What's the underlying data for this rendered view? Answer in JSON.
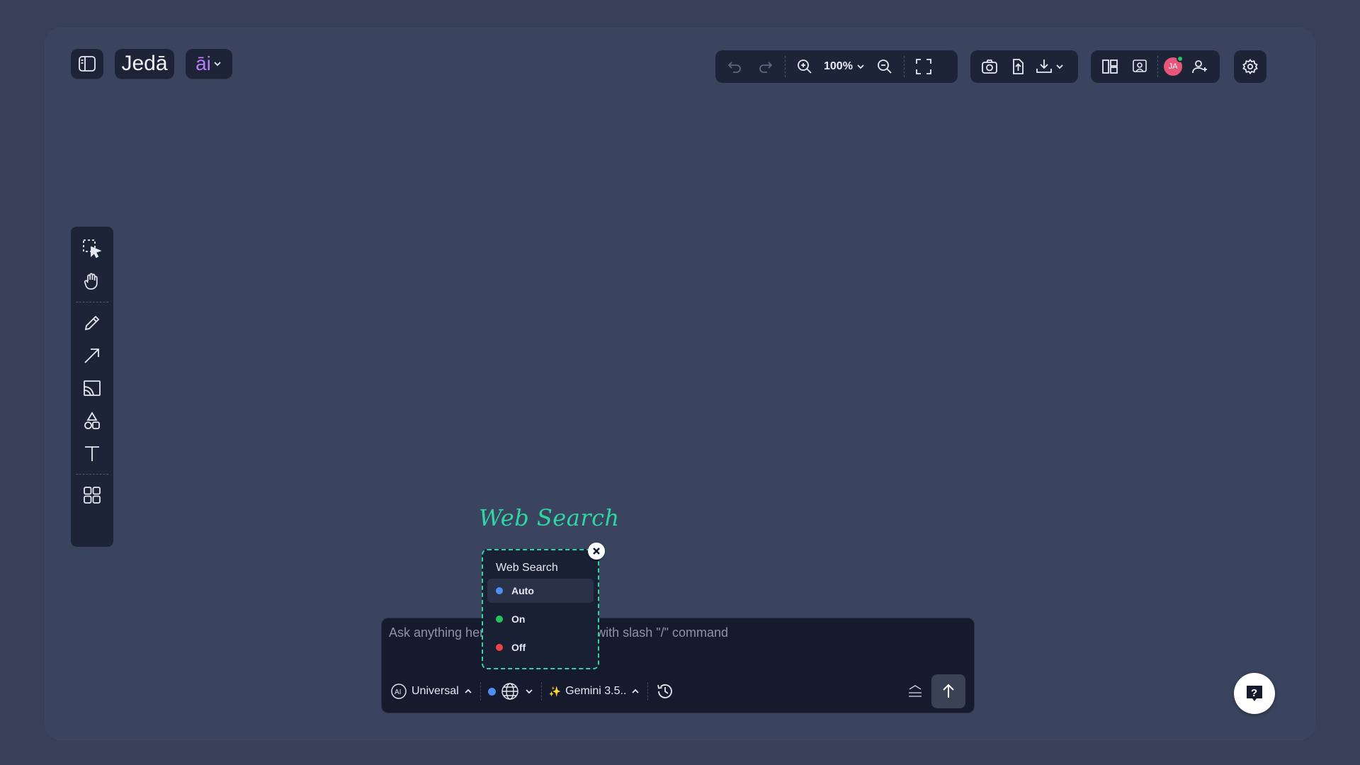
{
  "brand": {
    "logo_text": "Jedā",
    "ai_label": "āi"
  },
  "toolbar": {
    "zoom_level": "100%"
  },
  "user": {
    "initials": "JA"
  },
  "annotation": {
    "label": "Web Search"
  },
  "web_search_popover": {
    "title": "Web Search",
    "options": [
      {
        "label": "Auto",
        "color": "#4f8ef7",
        "selected": true
      },
      {
        "label": "On",
        "color": "#22c55e",
        "selected": false
      },
      {
        "label": "Off",
        "color": "#ef4444",
        "selected": false
      }
    ]
  },
  "composer": {
    "placeholder": "Ask anything here or create a space with slash \"/\" command",
    "mode_label": "Universal",
    "model_label": "Gemini 3.5..",
    "web_status_color": "#4f8ef7"
  },
  "colors": {
    "accent": "#2fd6a3",
    "panel": "#1e2438",
    "background": "#374058"
  }
}
